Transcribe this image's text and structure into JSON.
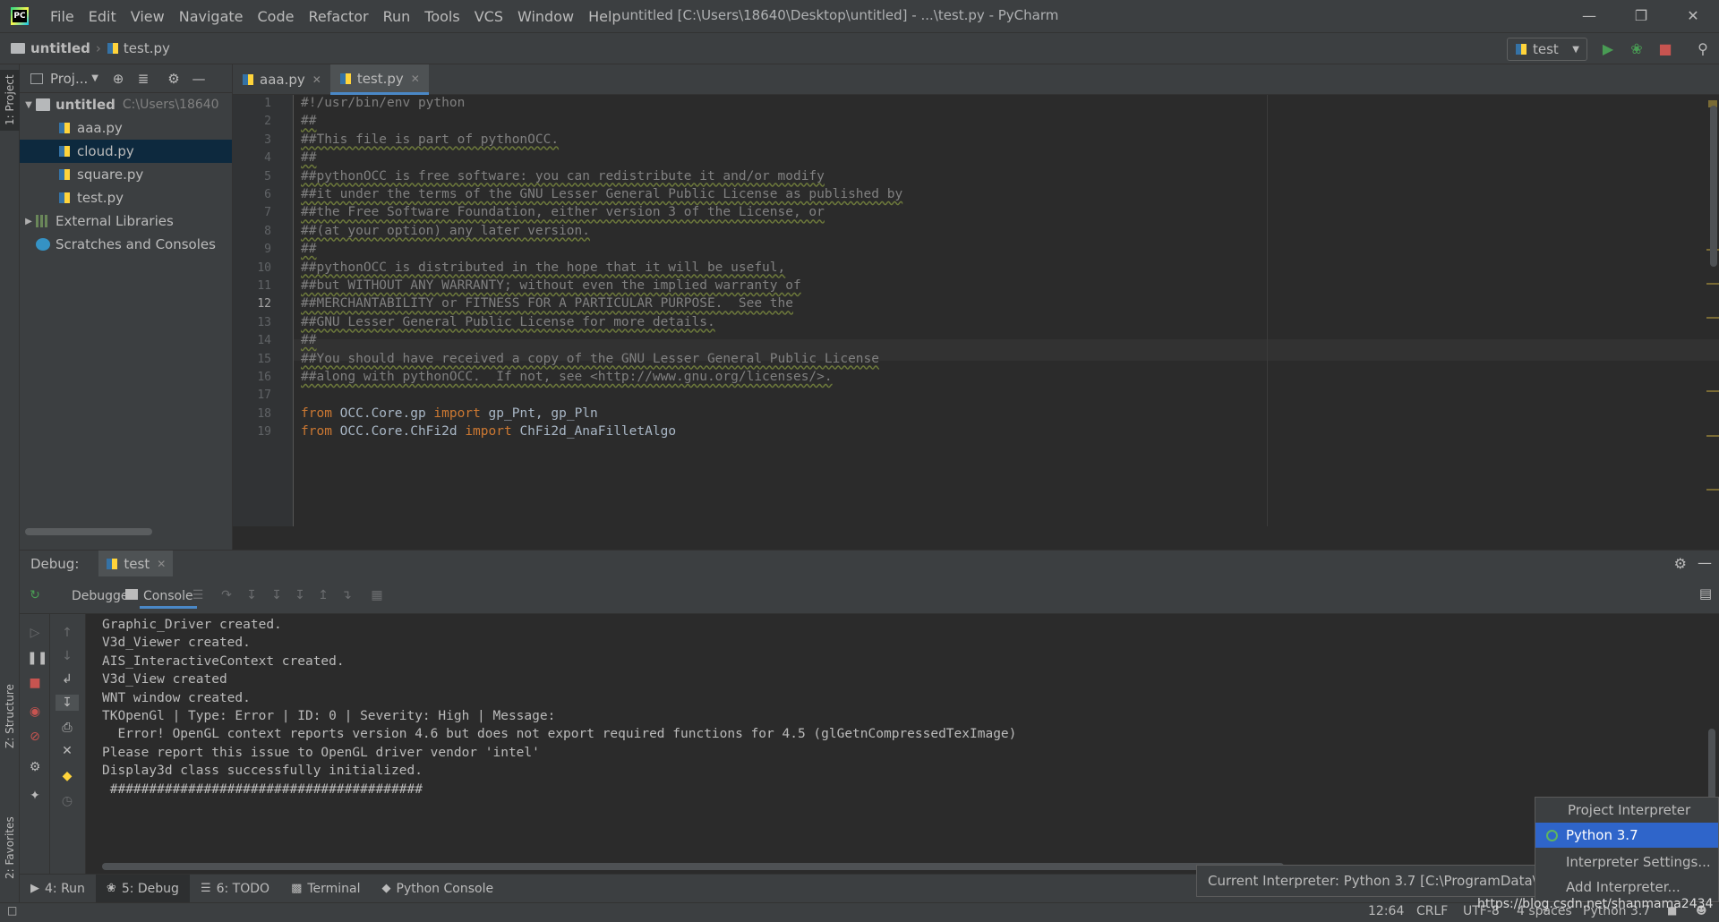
{
  "app": {
    "window_title": "untitled [C:\\Users\\18640\\Desktop\\untitled] - ...\\test.py - PyCharm",
    "menu": [
      "File",
      "Edit",
      "View",
      "Navigate",
      "Code",
      "Refactor",
      "Run",
      "Tools",
      "VCS",
      "Window",
      "Help"
    ]
  },
  "navbar": {
    "project": "untitled",
    "file": "test.py",
    "run_config": "test"
  },
  "left_strip": {
    "project_tab": "1: Project",
    "structure_tab": "Z: Structure",
    "favorites_tab": "2: Favorites"
  },
  "project_panel": {
    "title": "Proj...",
    "tree": [
      {
        "label": "untitled",
        "path": "C:\\Users\\18640",
        "type": "folder",
        "expanded": true
      },
      {
        "label": "aaa.py",
        "type": "file"
      },
      {
        "label": "cloud.py",
        "type": "file",
        "selected": true
      },
      {
        "label": "square.py",
        "type": "file"
      },
      {
        "label": "test.py",
        "type": "file"
      },
      {
        "label": "External Libraries",
        "type": "lib"
      },
      {
        "label": "Scratches and Consoles",
        "type": "scratch"
      }
    ]
  },
  "editor_tabs": [
    {
      "label": "aaa.py",
      "active": false
    },
    {
      "label": "test.py",
      "active": true
    }
  ],
  "editor": {
    "current_line": 12,
    "lines": [
      {
        "n": "1",
        "text": "#!/usr/bin/env python"
      },
      {
        "n": "2",
        "text": "##"
      },
      {
        "n": "3",
        "text": "##This file is part of pythonOCC."
      },
      {
        "n": "4",
        "text": "##"
      },
      {
        "n": "5",
        "text": "##pythonOCC is free software: you can redistribute it and/or modify"
      },
      {
        "n": "6",
        "text": "##it under the terms of the GNU Lesser General Public License as published by"
      },
      {
        "n": "7",
        "text": "##the Free Software Foundation, either version 3 of the License, or"
      },
      {
        "n": "8",
        "text": "##(at your option) any later version."
      },
      {
        "n": "9",
        "text": "##"
      },
      {
        "n": "10",
        "text": "##pythonOCC is distributed in the hope that it will be useful,"
      },
      {
        "n": "11",
        "text": "##but WITHOUT ANY WARRANTY; without even the implied warranty of"
      },
      {
        "n": "12",
        "text": "##MERCHANTABILITY or FITNESS FOR A PARTICULAR PURPOSE.  See the"
      },
      {
        "n": "13",
        "text": "##GNU Lesser General Public License for more details."
      },
      {
        "n": "14",
        "text": "##"
      },
      {
        "n": "15",
        "text": "##You should have received a copy of the GNU Lesser General Public License"
      },
      {
        "n": "16",
        "text": "##along with pythonOCC.  If not, see <http://www.gnu.org/licenses/>."
      },
      {
        "n": "17",
        "text": ""
      },
      {
        "n": "18",
        "text": "",
        "kw1": "from",
        "mod": " OCC.Core.gp ",
        "kw2": "import",
        "rest": " gp_Pnt, gp_Pln"
      },
      {
        "n": "19",
        "text": "",
        "kw1": "from",
        "mod": " OCC.Core.ChFi2d ",
        "kw2": "import",
        "rest": " ChFi2d_AnaFilletAlgo"
      }
    ]
  },
  "debug": {
    "label": "Debug:",
    "session": "test",
    "tabs": {
      "debugger": "Debugger",
      "console": "Console"
    },
    "console_lines": [
      "Graphic_Driver created.",
      "V3d_Viewer created.",
      "AIS_InteractiveContext created.",
      "V3d_View created",
      "WNT window created.",
      "TKOpenGl | Type: Error | ID: 0 | Severity: High | Message:",
      "  Error! OpenGL context reports version 4.6 but does not export required functions for 4.5 (glGetnCompressedTexImage)",
      "Please report this issue to OpenGL driver vendor 'intel'",
      "Display3d class successfully initialized.",
      " ########################################"
    ]
  },
  "bottom_tabs": [
    {
      "label": "4: Run",
      "icon": "play-icon"
    },
    {
      "label": "5: Debug",
      "icon": "bug-icon",
      "active": true
    },
    {
      "label": "6: TODO",
      "icon": "list-icon"
    },
    {
      "label": "Terminal",
      "icon": "terminal-icon"
    },
    {
      "label": "Python Console",
      "icon": "python-icon"
    }
  ],
  "status": {
    "position": "12:64",
    "line_sep": "CRLF",
    "encoding": "UTF-8",
    "indent": "4 spaces",
    "interpreter": "Python 3.7"
  },
  "interpreter_popup": {
    "header": "Project Interpreter",
    "selected": "Python 3.7",
    "settings": "Interpreter Settings...",
    "add": "Add Interpreter..."
  },
  "tooltip": "Current Interpreter: Python 3.7 [C:\\ProgramData\\A",
  "watermark": "https://blog.csdn.net/shanmama2434",
  "colors": {
    "accent": "#4a88c7",
    "run_green": "#499c54",
    "stop_red": "#c75450",
    "popup_select": "#2f65ca"
  }
}
